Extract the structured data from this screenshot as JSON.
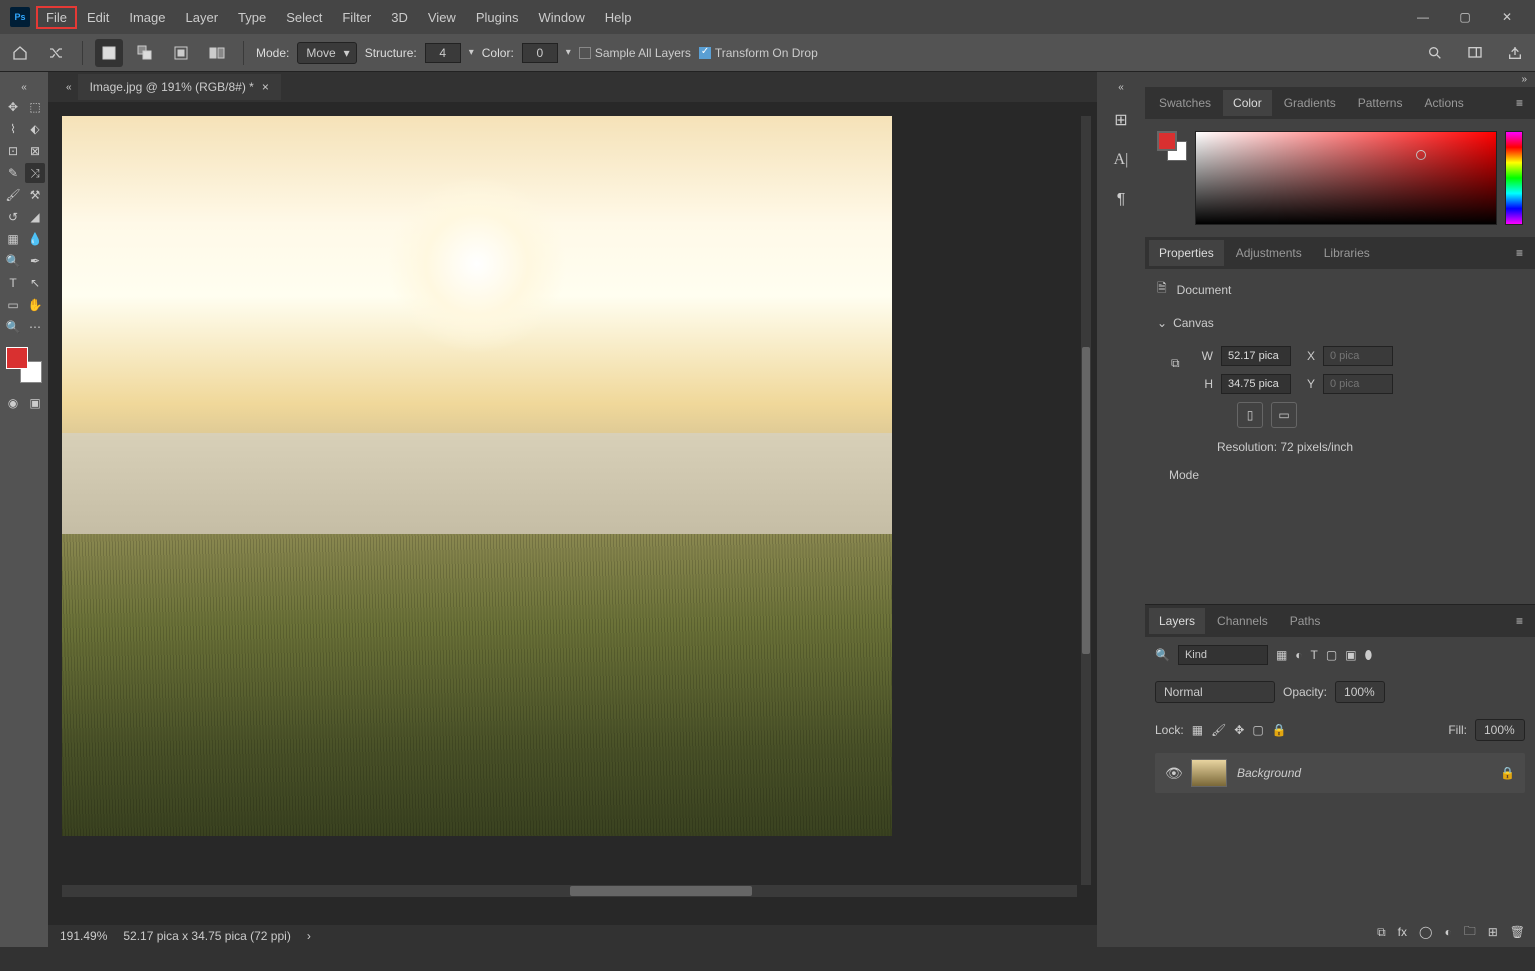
{
  "menu": {
    "items": [
      "File",
      "Edit",
      "Image",
      "Layer",
      "Type",
      "Select",
      "Filter",
      "3D",
      "View",
      "Plugins",
      "Window",
      "Help"
    ],
    "highlighted": "File"
  },
  "options": {
    "mode_label": "Mode:",
    "mode_value": "Move",
    "structure_label": "Structure:",
    "structure_value": "4",
    "color_label": "Color:",
    "color_value": "0",
    "sample_all": "Sample All Layers",
    "transform": "Transform On Drop"
  },
  "document": {
    "tab": "Image.jpg @ 191% (RGB/8#) *",
    "zoom": "191.49%",
    "dims": "52.17 pica x 34.75 pica (72 ppi)"
  },
  "panels": {
    "color_tabs": [
      "Swatches",
      "Color",
      "Gradients",
      "Patterns",
      "Actions"
    ],
    "color_active": "Color",
    "prop_tabs": [
      "Properties",
      "Adjustments",
      "Libraries"
    ],
    "prop_active": "Properties",
    "layer_tabs": [
      "Layers",
      "Channels",
      "Paths"
    ],
    "layer_active": "Layers"
  },
  "properties": {
    "doc_label": "Document",
    "canvas_label": "Canvas",
    "w_label": "W",
    "w_value": "52.17 pica",
    "x_label": "X",
    "x_placeholder": "0 pica",
    "h_label": "H",
    "h_value": "34.75 pica",
    "y_label": "Y",
    "y_placeholder": "0 pica",
    "resolution": "Resolution: 72 pixels/inch",
    "mode": "Mode"
  },
  "layers": {
    "kind": "Kind",
    "blend": "Normal",
    "opacity_label": "Opacity:",
    "opacity": "100%",
    "lock_label": "Lock:",
    "fill_label": "Fill:",
    "fill": "100%",
    "bg_layer": "Background"
  },
  "colors": {
    "fg": "#d93030",
    "bg": "#ffffff"
  }
}
